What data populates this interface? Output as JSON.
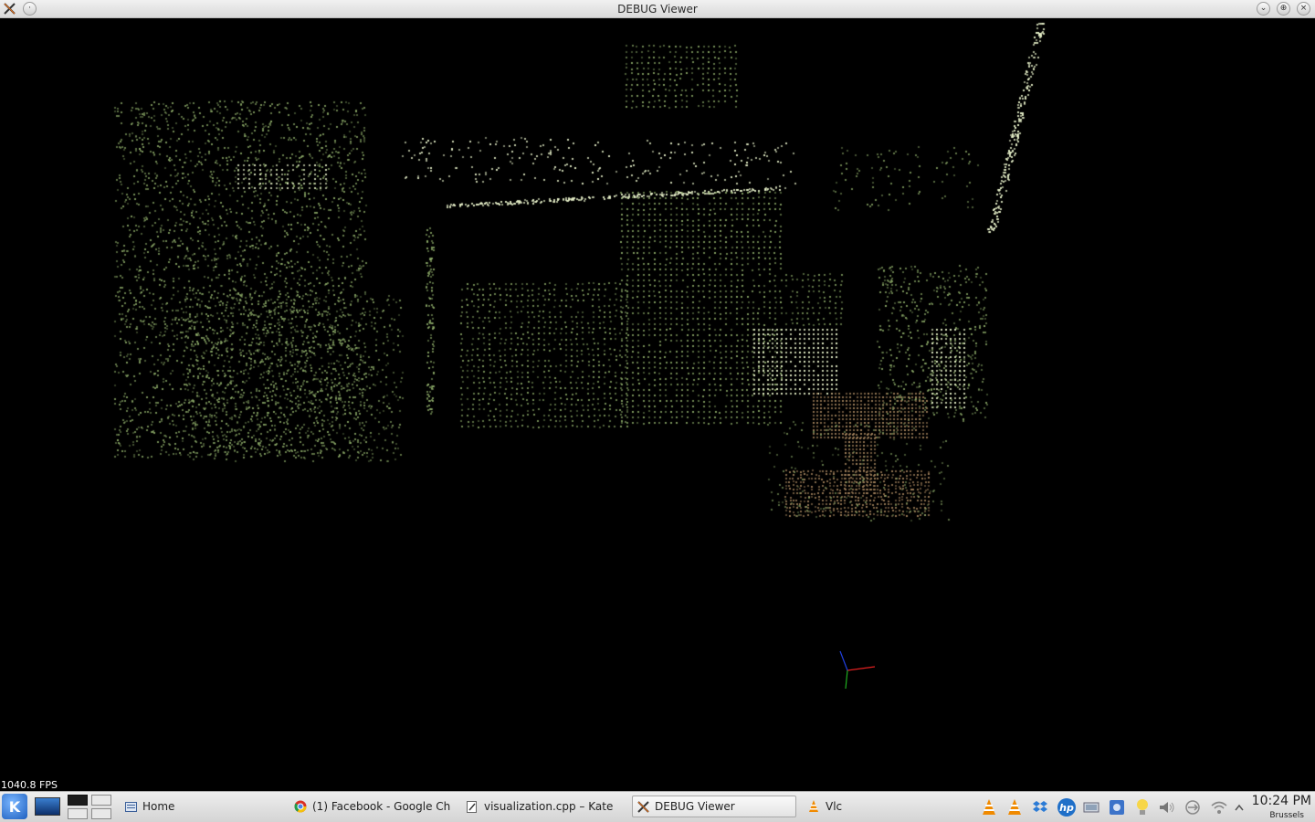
{
  "window": {
    "title": "DEBUG Viewer",
    "buttons": [
      "minimize-icon",
      "maximize-icon",
      "close-icon"
    ]
  },
  "viewer": {
    "fps_text": "1040.8 FPS",
    "background": "#000000",
    "point_colors": {
      "scene": "#8fae6a",
      "highlight": "#e6f0c8",
      "object": "#a0805a"
    },
    "axes_colors": {
      "x": "#e02020",
      "y": "#20b020",
      "z": "#2040e0"
    }
  },
  "taskbar": {
    "launcher_icon": "kde-icon",
    "show_desktop_icon": "desktop-icon",
    "pager": {
      "desktops": 4,
      "active": 1
    },
    "tasks": [
      {
        "label": "Home",
        "icon": "folder-icon",
        "active": false
      },
      {
        "label": "(1) Facebook - Google Chrome",
        "icon": "chrome-icon",
        "active": false
      },
      {
        "label": "visualization.cpp – Kate",
        "icon": "kate-icon",
        "active": false
      },
      {
        "label": "DEBUG Viewer",
        "icon": "x-icon",
        "active": true
      },
      {
        "label": "Vlc",
        "icon": "vlc-icon",
        "active": false
      }
    ],
    "tray": [
      "vlc-icon",
      "vlc-icon",
      "dropbox-icon",
      "hp-icon",
      "network-icon",
      "klipper-icon",
      "bulb-icon",
      "volume-icon",
      "usb-icon",
      "wifi-icon",
      "tray-expand-icon"
    ],
    "clock": {
      "time": "10:24 PM",
      "city": "Brussels"
    }
  }
}
